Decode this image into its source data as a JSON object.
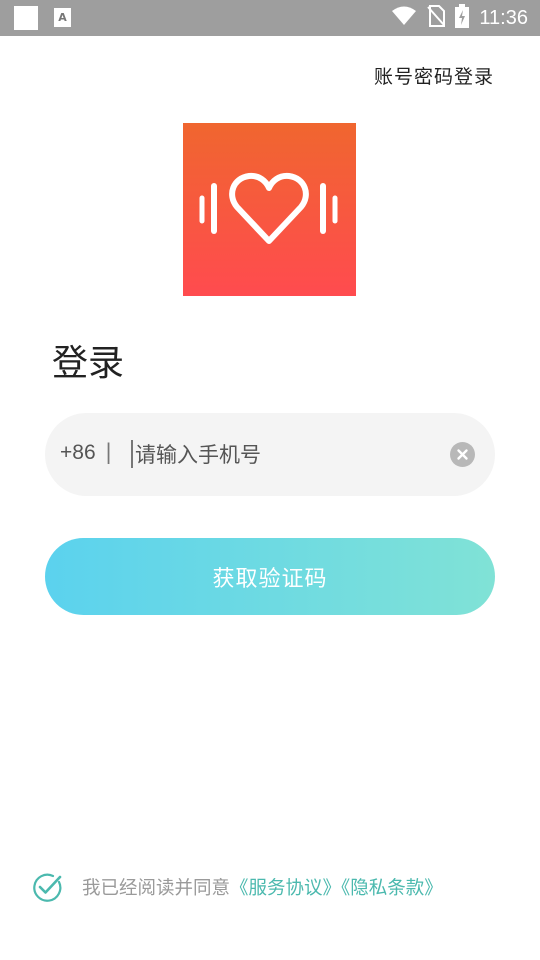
{
  "status_bar": {
    "time": "11:36",
    "icons": [
      "notification-square-icon",
      "text-app-icon",
      "wifi-icon",
      "no-sim-icon",
      "battery-charging-icon"
    ]
  },
  "header": {
    "password_login_label": "账号密码登录"
  },
  "logo": {
    "icon": "heart-dumbbell-logo",
    "gradient_top": "#f0662f",
    "gradient_bottom": "#ff4b4f"
  },
  "login": {
    "title": "登录",
    "country_code": "+86",
    "separator": "|",
    "phone_placeholder": "请输入手机号",
    "phone_value": "",
    "get_code_label": "获取验证码",
    "button_gradient": [
      "#5bd2ee",
      "#80e2d6"
    ]
  },
  "agreement": {
    "checked": true,
    "text_prefix": "我已经阅读并同意",
    "service_link": "《服务协议》",
    "privacy_link": "《隐私条款》",
    "link_color": "#4bb9ae"
  }
}
